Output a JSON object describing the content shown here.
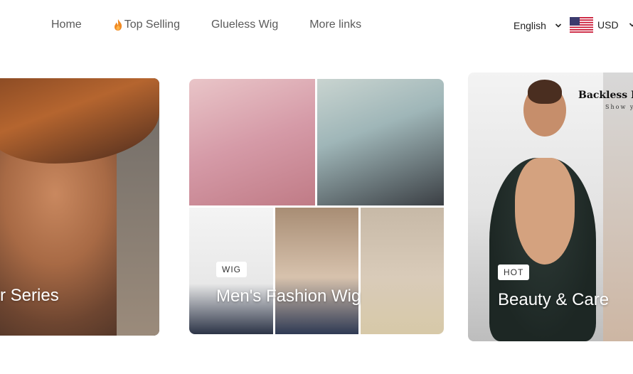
{
  "nav": {
    "items": [
      {
        "label": "Home"
      },
      {
        "label": "Top Selling",
        "icon": "flame-icon"
      },
      {
        "label": "Glueless Wig"
      },
      {
        "label": "More links"
      }
    ]
  },
  "header": {
    "language": "English",
    "currency": "USD",
    "currency_flag": "us-flag-icon"
  },
  "cards": [
    {
      "title": "r Series"
    },
    {
      "badge": "WIG",
      "title": "Men's Fashion Wig"
    },
    {
      "badge": "HOT",
      "title": "Beauty & Care",
      "image_text_1": "Backless I",
      "image_text_2": "Show y"
    }
  ]
}
